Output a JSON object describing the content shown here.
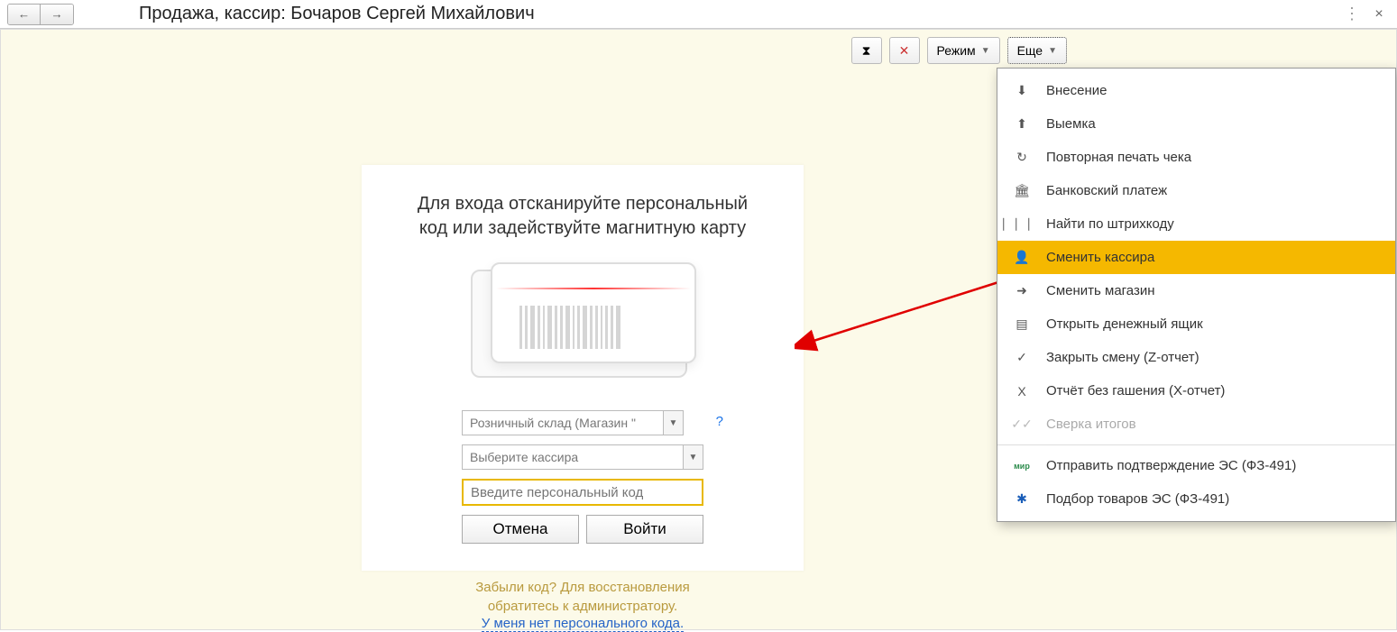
{
  "header": {
    "title": "Продажа, кассир: Бочаров Сергей Михайлович"
  },
  "toolbar": {
    "mode_label": "Режим",
    "more_label": "Еще"
  },
  "login": {
    "line1": "Для входа отсканируйте персональный",
    "line2": "код или задействуйте магнитную карту",
    "store_value": "Розничный склад (Магазин \"",
    "cashier_placeholder": "Выберите кассира",
    "code_placeholder": "Введите персональный код",
    "cancel": "Отмена",
    "enter": "Войти",
    "forgot1": "Забыли код? Для восстановления",
    "forgot2": "обратитесь к администратору.",
    "no_code": "У меня нет персонального кода."
  },
  "menu": {
    "items": [
      {
        "label": "Внесение",
        "icon": "⬇"
      },
      {
        "label": "Выемка",
        "icon": "⬆"
      },
      {
        "label": "Повторная печать чека",
        "icon": "↻"
      },
      {
        "label": "Банковский платеж",
        "icon": "🏛"
      },
      {
        "label": "Найти по штрихкоду",
        "icon": "⎸⎸⎸"
      },
      {
        "label": "Сменить кассира",
        "icon": "👤",
        "highlighted": true
      },
      {
        "label": "Сменить магазин",
        "icon": "➜"
      },
      {
        "label": "Открыть денежный ящик",
        "icon": "▤"
      },
      {
        "label": "Закрыть смену (Z-отчет)",
        "icon": "✓"
      },
      {
        "label": "Отчёт без гашения (X-отчет)",
        "icon": "X"
      },
      {
        "label": "Сверка итогов",
        "icon": "✓✓",
        "disabled": true
      },
      {
        "separator": true
      },
      {
        "label": "Отправить подтверждение ЭС (ФЗ-491)",
        "icon": "мир",
        "icon_color": "#2a8a4a"
      },
      {
        "label": "Подбор товаров ЭС (ФЗ-491)",
        "icon": "✱",
        "icon_color": "#1a5db8"
      }
    ]
  }
}
